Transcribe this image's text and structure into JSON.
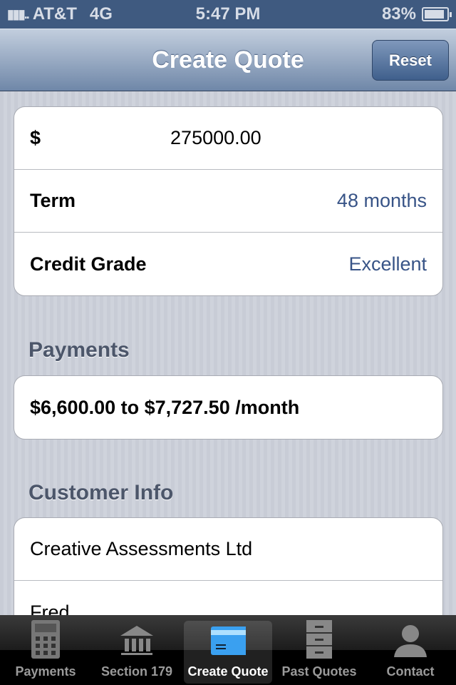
{
  "status": {
    "carrier": "AT&T",
    "network": "4G",
    "time": "5:47 PM",
    "battery": "83%",
    "battery_level": 0.83
  },
  "nav": {
    "title": "Create Quote",
    "reset_label": "Reset"
  },
  "quote": {
    "currency_symbol": "$",
    "amount": "275000.00",
    "term_label": "Term",
    "term_value": "48 months",
    "credit_label": "Credit Grade",
    "credit_value": "Excellent"
  },
  "payments": {
    "header": "Payments",
    "range": "$6,600.00 to $7,727.50 /month"
  },
  "customer": {
    "header": "Customer Info",
    "company": "Creative Assessments Ltd",
    "name": "Fred"
  },
  "tabs": [
    {
      "label": "Payments",
      "icon": "calculator-icon"
    },
    {
      "label": "Section 179",
      "icon": "bank-icon"
    },
    {
      "label": "Create Quote",
      "icon": "credit-card-icon",
      "active": true
    },
    {
      "label": "Past Quotes",
      "icon": "file-cabinet-icon"
    },
    {
      "label": "Contact",
      "icon": "person-icon"
    }
  ],
  "colors": {
    "accent": "#385487",
    "nav": "#3f5a80"
  }
}
